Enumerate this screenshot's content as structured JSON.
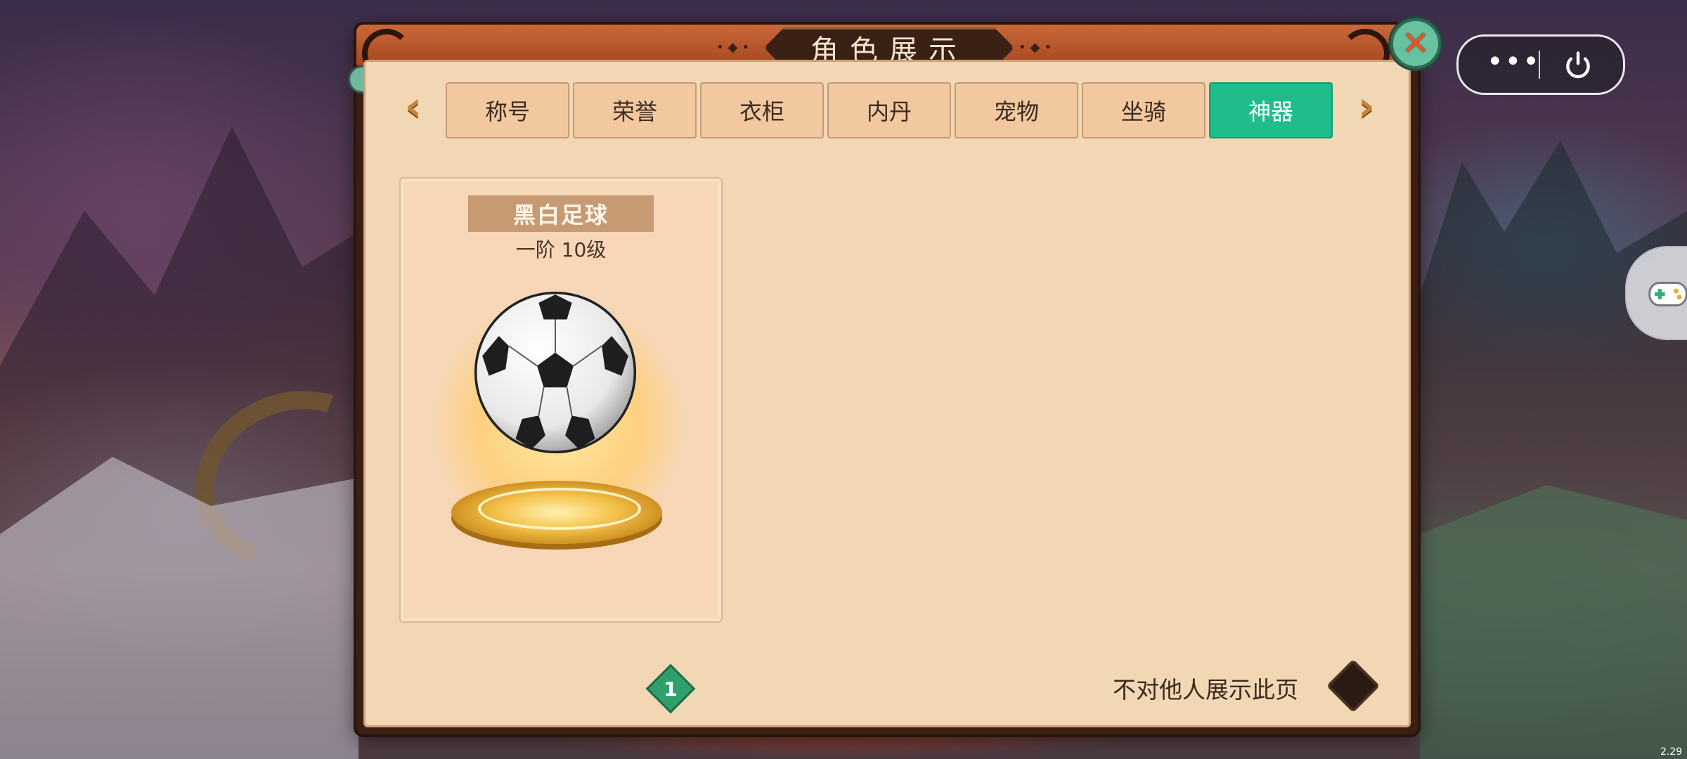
{
  "panel": {
    "title": "角色展示",
    "tabs": [
      {
        "label": "称号",
        "active": false
      },
      {
        "label": "荣誉",
        "active": false
      },
      {
        "label": "衣柜",
        "active": false
      },
      {
        "label": "内丹",
        "active": false
      },
      {
        "label": "宠物",
        "active": false
      },
      {
        "label": "坐骑",
        "active": false
      },
      {
        "label": "神器",
        "active": true
      }
    ],
    "item": {
      "name": "黑白足球",
      "level": "一阶 10级"
    },
    "page": "1",
    "hide_toggle_label": "不对他人展示此页"
  },
  "version": "2.29",
  "colors": {
    "active_tab": "#1fbd8c",
    "panel_bg": "#f1d7b4",
    "tab_bg": "#f2c8a0"
  },
  "icons": {
    "close": "close-x-icon",
    "prev": "chevron-left-icon",
    "next": "chevron-right-icon",
    "more": "more-dots-icon",
    "power": "power-icon"
  }
}
